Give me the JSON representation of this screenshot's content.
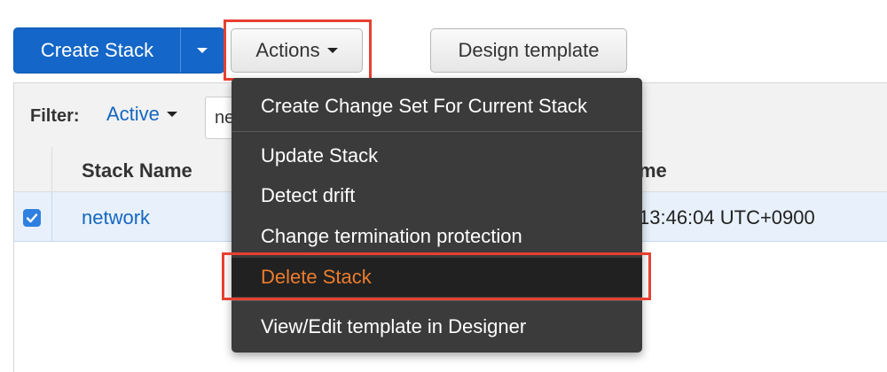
{
  "toolbar": {
    "create_stack_label": "Create Stack",
    "actions_label": "Actions",
    "design_template_label": "Design template"
  },
  "filter": {
    "label": "Filter:",
    "value": "Active",
    "search_text": "ne"
  },
  "table": {
    "columns": [
      "Stack Name",
      "me"
    ],
    "rows": [
      {
        "checked": true,
        "name": "network",
        "time": "13:46:04 UTC+0900"
      }
    ]
  },
  "actions_menu": {
    "items": [
      {
        "label": "Create Change Set For Current Stack"
      },
      {
        "label": "Update Stack"
      },
      {
        "label": "Detect drift"
      },
      {
        "label": "Change termination protection"
      },
      {
        "label": "Delete Stack"
      },
      {
        "label": "View/Edit template in Designer"
      }
    ]
  },
  "colors": {
    "primary_blue": "#1466c8",
    "link_blue": "#1566c0",
    "highlight_red": "#e8402f",
    "menu_bg": "#3b3b3b",
    "danger_orange": "#ec7d2c"
  }
}
